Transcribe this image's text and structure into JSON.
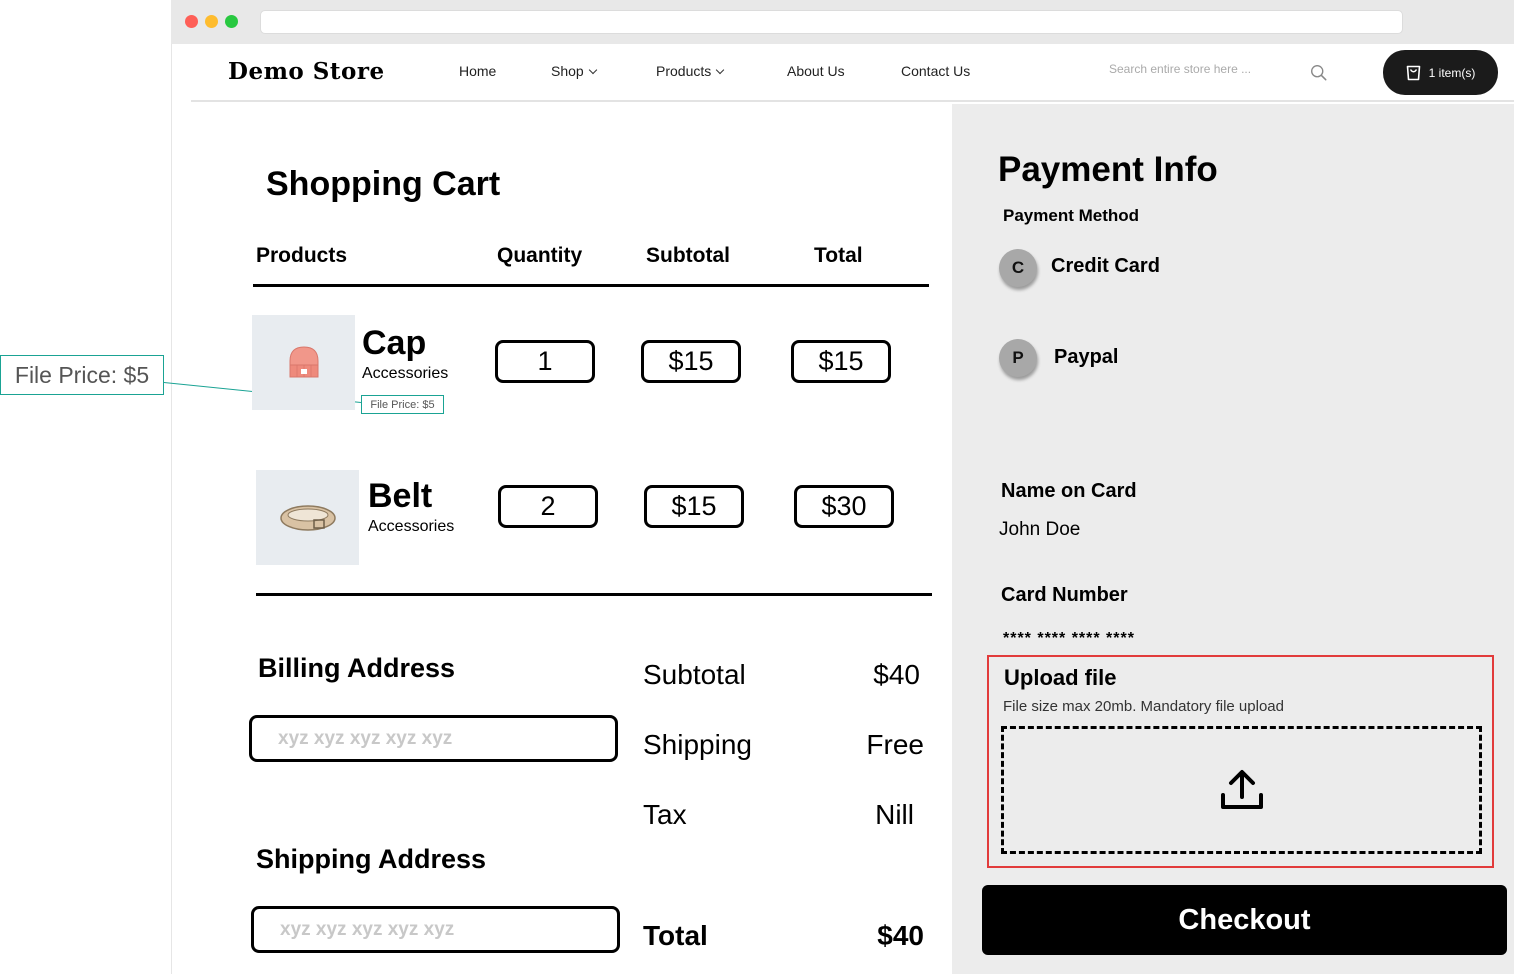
{
  "header": {
    "logo": "Demo Store",
    "nav": [
      "Home",
      "Shop",
      "Products",
      "About Us",
      "Contact Us"
    ],
    "search_placeholder": "Search entire store here ...",
    "cart_label": "1 item(s)"
  },
  "annotation": {
    "large": "File Price: $5",
    "small": "File Price: $5"
  },
  "cart": {
    "title": "Shopping Cart",
    "columns": [
      "Products",
      "Quantity",
      "Subtotal",
      "Total"
    ],
    "items": [
      {
        "name": "Cap",
        "category": "Accessories",
        "quantity": "1",
        "subtotal": "$15",
        "total": "$15"
      },
      {
        "name": "Belt",
        "category": "Accessories",
        "quantity": "2",
        "subtotal": "$15",
        "total": "$30"
      }
    ]
  },
  "billing": {
    "title": "Billing Address",
    "placeholder": "xyz xyz xyz xyz xyz"
  },
  "shipping": {
    "title": "Shipping Address",
    "placeholder": "xyz xyz xyz xyz xyz"
  },
  "summary": {
    "subtotal_label": "Subtotal",
    "subtotal_value": "$40",
    "shipping_label": "Shipping",
    "shipping_value": "Free",
    "tax_label": "Tax",
    "tax_value": "Nill",
    "total_label": "Total",
    "total_value": "$40"
  },
  "payment": {
    "title": "Payment Info",
    "method_label": "Payment Method",
    "methods": [
      {
        "initial": "C",
        "label": "Credit Card"
      },
      {
        "initial": "P",
        "label": "Paypal"
      }
    ],
    "name_label": "Name on Card",
    "name_value": "John Doe",
    "card_label": "Card Number",
    "card_value": "**** **** **** ****",
    "upload_title": "Upload file",
    "upload_hint": "File size max 20mb. Mandatory file upload",
    "checkout": "Checkout"
  },
  "colors": {
    "accent_teal": "#1aa394",
    "upload_border": "#e23b3b",
    "panel_bg": "#ececec",
    "button_bg": "#000000"
  },
  "icons": [
    "search-icon",
    "cart-icon",
    "upload-icon",
    "chevron-down-icon"
  ]
}
